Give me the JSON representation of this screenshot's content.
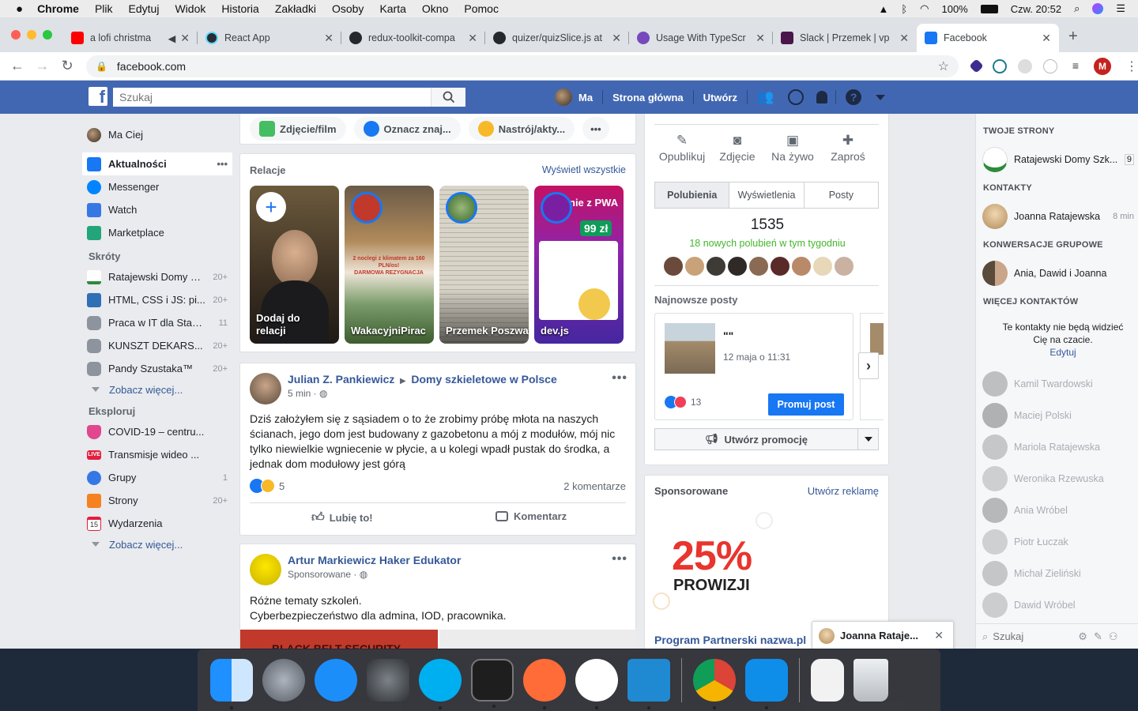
{
  "mac_menu": {
    "app": "Chrome",
    "items": [
      "Plik",
      "Edytuj",
      "Widok",
      "Historia",
      "Zakładki",
      "Osoby",
      "Karta",
      "Okno",
      "Pomoc"
    ],
    "battery": "100%",
    "clock": "Czw. 20:52"
  },
  "browser": {
    "tabs": [
      {
        "title": "a lofi christma",
        "color": "#ff0000"
      },
      {
        "title": "React App",
        "color": "#61dafb"
      },
      {
        "title": "redux-toolkit-compa",
        "color": "#24292e"
      },
      {
        "title": "quizer/quizSlice.js at",
        "color": "#24292e"
      },
      {
        "title": "Usage With TypeScr",
        "color": "#764abc"
      },
      {
        "title": "Slack | Przemek | vp",
        "color": "#4a154b"
      },
      {
        "title": "Facebook",
        "color": "#1877f2"
      }
    ],
    "url": "facebook.com",
    "profile_initial": "M"
  },
  "fb_header": {
    "logo": "f",
    "search_placeholder": "Szukaj",
    "user": "Ma",
    "home": "Strona główna",
    "create": "Utwórz"
  },
  "left_nav": {
    "profile": "Ma Ciej",
    "main": [
      {
        "label": "Aktualności",
        "more": "•••"
      },
      {
        "label": "Messenger"
      },
      {
        "label": "Watch"
      },
      {
        "label": "Marketplace"
      }
    ],
    "shortcuts_title": "Skróty",
    "shortcuts": [
      {
        "label": "Ratajewski Domy S...",
        "count": "20+"
      },
      {
        "label": "HTML, CSS i JS: pi...",
        "count": "20+"
      },
      {
        "label": "Praca w IT dla Staż...",
        "count": "11"
      },
      {
        "label": "KUNSZT DEKARS...",
        "count": "20+"
      },
      {
        "label": "Pandy Szustaka™",
        "count": "20+"
      }
    ],
    "see_more": "Zobacz więcej...",
    "explore_title": "Eksploruj",
    "explore": [
      {
        "label": "COVID-19 – centru...",
        "count": ""
      },
      {
        "label": "Transmisje wideo ...",
        "count": ""
      },
      {
        "label": "Grupy",
        "count": "1"
      },
      {
        "label": "Strony",
        "count": "20+"
      },
      {
        "label": "Wydarzenia",
        "count": ""
      }
    ],
    "live_badge": "LIVE",
    "calendar_day": "15"
  },
  "composer": {
    "photo": "Zdjęcie/film",
    "tag": "Oznacz znaj...",
    "feeling": "Nastrój/akty...",
    "more": "•••"
  },
  "stories": {
    "title": "Relacje",
    "see_all": "Wyświetl wszystkie",
    "items": [
      {
        "name": "Dodaj do relacji"
      },
      {
        "name": "WakacyjniPirac"
      },
      {
        "name": "Przemek Poszwa"
      },
      {
        "name": "dev.js"
      }
    ],
    "ad_story_text1": "2 noclegi z klimatem za 160 PLN/os!",
    "ad_story_text2": "DARMOWA REZYGNACJA",
    "devjs_price": "99 zł",
    "devjs_title": "nie z PWA"
  },
  "post1": {
    "author": "Julian Z. Pankiewicz",
    "group": "Domy szkieletowe w Polsce",
    "time": "5 min ·",
    "text": "Dziś założyłem się z sąsiadem o to że zrobimy próbę młota na naszych ścianach, jego dom jest budowany z gazobetonu a mój z modułów, mój nic tylko niewielkie wgniecenie w płycie, a u kolegi wpadł pustak do środka, a jednak dom modułowy jest górą",
    "reactions": "5",
    "comments": "2 komentarze",
    "like": "Lubię to!",
    "comment": "Komentarz",
    "more": "•••"
  },
  "post2": {
    "author": "Artur Markiewicz Haker Edukator",
    "sub": "Sponsorowane ·",
    "text1": "Różne tematy szkoleń.",
    "text2": "Cyberbezpieczeństwo dla admina, IOD, pracownika.",
    "banner": "BLACK BELT SECURITY",
    "more": "•••"
  },
  "page_panel": {
    "tools": [
      {
        "label": "Opublikuj",
        "icon": "✎"
      },
      {
        "label": "Zdjęcie",
        "icon": "◙"
      },
      {
        "label": "Na żywo",
        "icon": "▣"
      },
      {
        "label": "Zaproś",
        "icon": "✚"
      }
    ],
    "tabs": [
      "Polubienia",
      "Wyświetlenia",
      "Posty"
    ],
    "likes": "1535",
    "new_likes": "18 nowych polubień w tym tygodniu",
    "latest_title": "Najnowsze posty",
    "post_title": "\"\"",
    "post_date": "12 maja o 11:31",
    "post_reactions": "13",
    "promote": "Promuj post",
    "create_promo": "Utwórz promocję"
  },
  "sponsored": {
    "title": "Sponsorowane",
    "create_ad": "Utwórz reklamę",
    "big": "25%",
    "small": "PROWIZJI",
    "link": "Program Partnerski nazwa.pl"
  },
  "chat": {
    "your_pages": "TWOJE STRONY",
    "page": {
      "name": "Ratajewski Domy Szk...",
      "count": "9"
    },
    "contacts": "KONTAKTY",
    "contact": {
      "name": "Joanna Ratajewska",
      "time": "8 min"
    },
    "group_title": "KONWERSACJE GRUPOWE",
    "group": "Ania, Dawid i Joanna",
    "more_contacts": "WIĘCEJ KONTAKTÓW",
    "hidden_note": "Te kontakty nie będą widzieć Cię na czacie.",
    "edit": "Edytuj",
    "offline": [
      "Kamil Twardowski",
      "Maciej Polski",
      "Mariola Ratajewska",
      "Weronika Rzewuska",
      "Ania Wróbel",
      "Piotr Łuczak",
      "Michał Zieliński",
      "Dawid Wróbel"
    ],
    "search_placeholder": "Szukaj",
    "popup_name": "Joanna Rataje..."
  },
  "colors": {
    "fb_blue": "#4267b2",
    "link": "#365899",
    "green": "#42b72a"
  }
}
